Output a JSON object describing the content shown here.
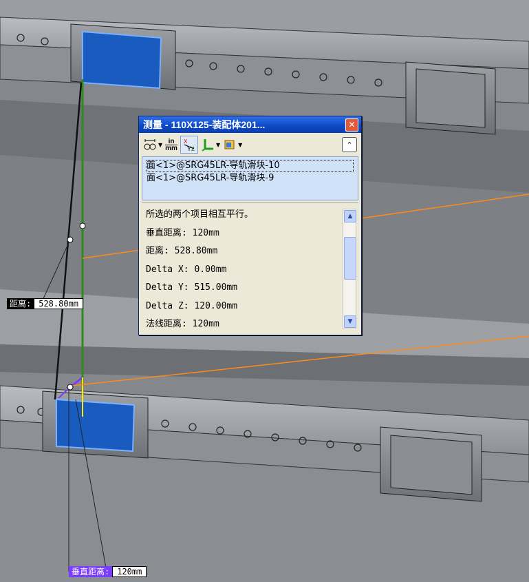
{
  "dialog": {
    "title": "测量 - 110X125-装配体201...",
    "close_symbol": "✕",
    "collapse_symbol": "⌃",
    "toolbar": {
      "units_top": "in",
      "units_bottom": "mm"
    },
    "selections": [
      "面<1>@SRG45LR-导轨滑块-10",
      "面<1>@SRG45LR-导轨滑块-9"
    ],
    "results": [
      "所选的两个项目相互平行。",
      "垂直距离: 120mm",
      "距离: 528.80mm",
      "Delta X: 0.00mm",
      "Delta Y: 515.00mm",
      "Delta Z: 120.00mm",
      "法线距离: 120mm"
    ]
  },
  "labels": {
    "distance": {
      "key": "距离:",
      "value": "528.80mm"
    },
    "perpendicular": {
      "key": "垂直距离:",
      "value": "120mm"
    }
  },
  "colors": {
    "face_highlight": "#1a5bbf",
    "measure_line": "#2e8b1e",
    "callout_line": "#ff8a1e",
    "perp_label": "#7a3cff",
    "title_bar": "#0b48c4"
  }
}
